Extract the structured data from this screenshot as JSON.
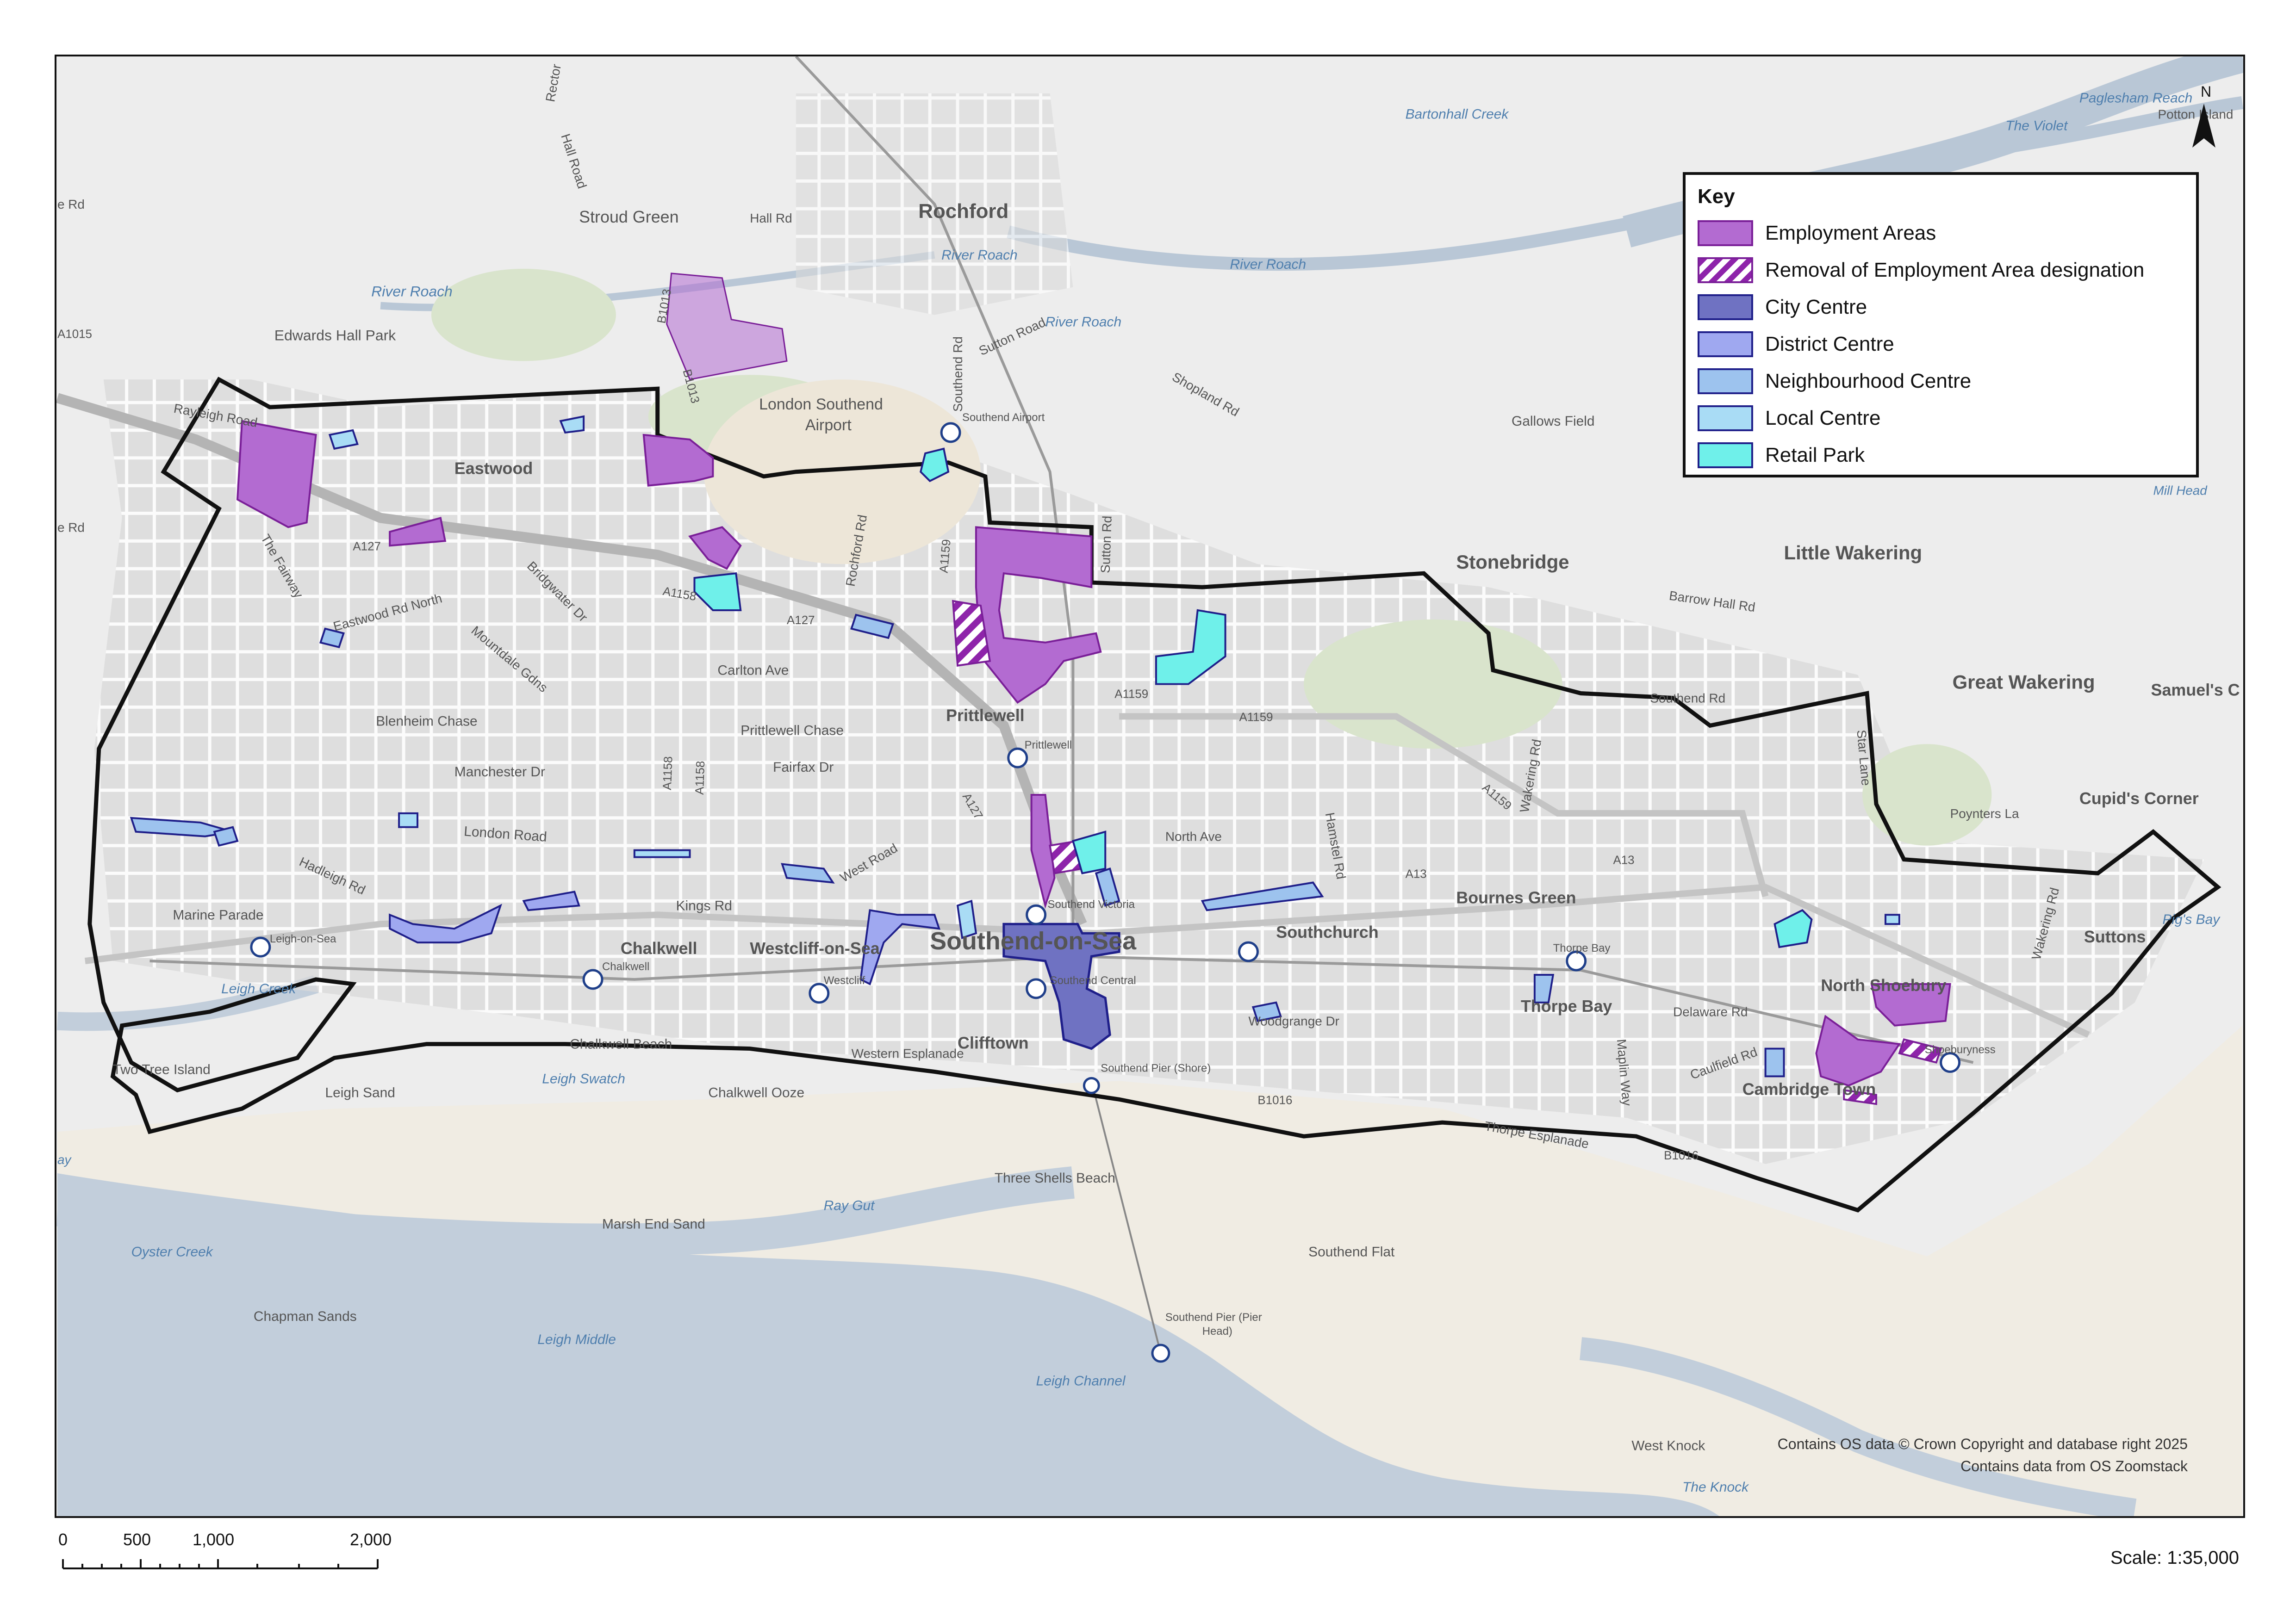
{
  "legend": {
    "title": "Key",
    "items": [
      {
        "label": "Employment Areas",
        "fill": "#b36bd1",
        "border": "#7a1f98",
        "pattern": "solid"
      },
      {
        "label": "Removal of Employment Area designation",
        "fill": "#8e24aa",
        "border": "#7a1f98",
        "pattern": "hatch"
      },
      {
        "label": "City Centre",
        "fill": "#6f72c2",
        "border": "#1f1f8a",
        "pattern": "solid"
      },
      {
        "label": "District Centre",
        "fill": "#9fa8f0",
        "border": "#1f1f8a",
        "pattern": "solid"
      },
      {
        "label": "Neighbourhood Centre",
        "fill": "#9dc3ee",
        "border": "#1f1f8a",
        "pattern": "solid"
      },
      {
        "label": "Local Centre",
        "fill": "#a9dcf5",
        "border": "#1f1f8a",
        "pattern": "solid"
      },
      {
        "label": "Retail Park",
        "fill": "#6ff0ea",
        "border": "#1f1f8a",
        "pattern": "solid"
      }
    ]
  },
  "north_label": "N",
  "scale": {
    "ticks": [
      "0",
      "500",
      "1,000",
      "2,000 Meters"
    ],
    "ratio": "Scale: 1:35,000"
  },
  "copyright": [
    "Contains OS data © Crown Copyright and database right 2025",
    "Contains data from OS Zoomstack"
  ],
  "places": {
    "rochford": "Rochford",
    "stroud_green": "Stroud Green",
    "edwards_hall_park": "Edwards Hall Park",
    "eastwood": "Eastwood",
    "london_southend_airport": "London Southend",
    "airport_2": "Airport",
    "prittlewell": "Prittlewell",
    "southend": "Southend-on-Sea",
    "stonebridge": "Stonebridge",
    "little_wakering": "Little Wakering",
    "great_wakering": "Great Wakering",
    "samuels": "Samuel's C",
    "gallows_field": "Gallows Field",
    "cupids_corner": "Cupid's Corner",
    "bournes_green": "Bournes Green",
    "southchurch": "Southchurch",
    "thorpe_bay": "Thorpe Bay",
    "north_shoebury": "North Shoebury",
    "suttons": "Suttons",
    "cambridge_town": "Cambridge Town",
    "chalkwell": "Chalkwell",
    "westcliff": "Westcliff-on-Sea",
    "clifftown": "Clifftown",
    "two_tree_island": "Two Tree Island",
    "leigh_on_sea": "Leigh-on-Sea",
    "shoeburyness": "Shoeburyness",
    "mill_head": "Mill Head",
    "potton_island": "Potton Island"
  },
  "water": {
    "river_roach_1": "River Roach",
    "river_roach_2": "River Roach",
    "river_roach_3": "River Roach",
    "river_roach_4": "River Roach",
    "bartonhall_creek": "Bartonhall Creek",
    "paglesham_reach": "Paglesham Reach",
    "the_violet": "The Violet",
    "leigh_creek": "Leigh Creek",
    "leigh_swatch": "Leigh Swatch",
    "ray_gut": "Ray Gut",
    "oyster_creek": "Oyster Creek",
    "leigh_middle": "Leigh Middle",
    "leigh_channel": "Leigh Channel",
    "the_knock": "The Knock",
    "pigs_bay": "Pig's Bay"
  },
  "sands": {
    "chalkwell_beach": "Chalkwell Beach",
    "leigh_sand": "Leigh Sand",
    "chalkwell_ooze": "Chalkwell Ooze",
    "three_shells_beach": "Three Shells Beach",
    "marsh_end_sand": "Marsh End Sand",
    "chapman_sands": "Chapman Sands",
    "southend_flat": "Southend Flat",
    "west_knock": "West Knock"
  },
  "roads": {
    "hall_road": "Hall Road",
    "hall_rd": "Hall Rd",
    "b1013": "B1013",
    "b1013b": "B1013",
    "a1015": "A1015",
    "rayleigh_road": "Rayleigh Road",
    "a127a": "A127",
    "a127b": "A127",
    "a127c": "A127",
    "a1158a": "A1158",
    "a1158b": "A1158",
    "a1158c": "A1158",
    "a1159a": "A1159",
    "a1159b": "A1159",
    "a1159c": "A1159",
    "a1159d": "A1159",
    "a13a": "A13",
    "a13b": "A13",
    "b1016a": "B1016",
    "b1016b": "B1016",
    "carlton_ave": "Carlton Ave",
    "blenheim_chase": "Blenheim Chase",
    "prittlewell_chase": "Prittlewell Chase",
    "manchester_dr": "Manchester Dr",
    "fairfax_dr": "Fairfax Dr",
    "london_road": "London Road",
    "kings_rd": "Kings Rd",
    "marine_parade": "Marine Parade",
    "hadleigh_rd": "Hadleigh Rd",
    "west_road": "West Road",
    "western_esplanade": "Western Esplanade",
    "north_ave": "North Ave",
    "hamstel_rd": "Hamstel Rd",
    "wakering_rd": "Wakering Rd",
    "wakering_rd2": "Wakering Rd",
    "southend_rd1": "Southend Rd",
    "southend_rd2": "Southend Rd",
    "sutton_rd": "Sutton Rd",
    "sutton_road": "Sutton Road",
    "shopland_rd": "Shopland Rd",
    "barrow_hall_rd": "Barrow Hall Rd",
    "poynters_la": "Poynters La",
    "star_lane": "Star Lane",
    "delaware_rd": "Delaware Rd",
    "caulfield_rd": "Caulfield Rd",
    "maplin_way": "Maplin Way",
    "thorpe_esplanade": "Thorpe Esplanade",
    "woodgrange_dr": "Woodgrange Dr",
    "the_fairway": "The Fairway",
    "eastwood_rd_north": "Eastwood Rd North",
    "mountdale_gdns": "Mountdale Gdns",
    "bridgwater_dr": "Bridgwater Dr",
    "rochford_rd": "Rochford Rd",
    "rectory": "Rector",
    "rd_edge": "e Rd",
    "rd_edge2": "e Rd"
  },
  "stations": {
    "southend_airport": "Southend Airport",
    "prittlewell": "Prittlewell",
    "southend_victoria": "Southend Victoria",
    "southend_central": "Southend Central",
    "westcliff": "Westcliff",
    "chalkwell": "Chalkwell",
    "leigh": "Leigh-on-Sea",
    "thorpe_bay": "Thorpe Bay",
    "shoeburyness": "Shoeburyness",
    "pier_shore": "Southend Pier (Shore)",
    "pier_head_1": "Southend Pier (Pier",
    "pier_head_2": "Head)"
  },
  "edge_labels": {
    "ay": "ay"
  }
}
